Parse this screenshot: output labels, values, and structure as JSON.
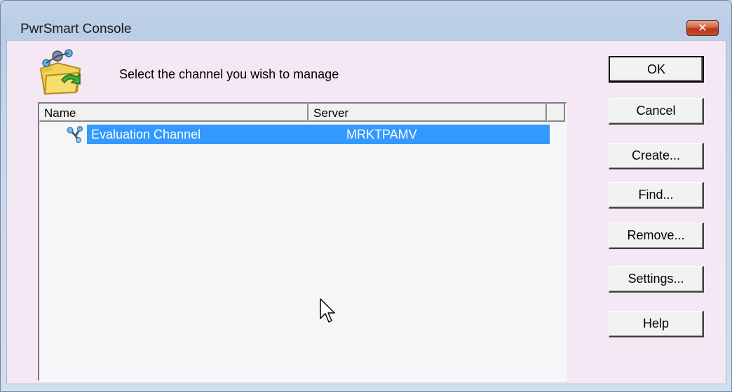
{
  "window": {
    "title": "PwrSmart Console",
    "close_label": "✕"
  },
  "dialog": {
    "instruction": "Select the channel you wish to manage"
  },
  "list": {
    "columns": [
      "Name",
      "Server"
    ],
    "rows": [
      {
        "name": "Evaluation Channel",
        "server": "MRKTPAMV",
        "selected": true
      }
    ]
  },
  "buttons": {
    "ok": "OK",
    "cancel": "Cancel",
    "create": "Create...",
    "find": "Find...",
    "remove": "Remove...",
    "settings": "Settings...",
    "help": "Help"
  },
  "colors": {
    "selection": "#3399ff",
    "client_bg": "#f3e8f3"
  }
}
